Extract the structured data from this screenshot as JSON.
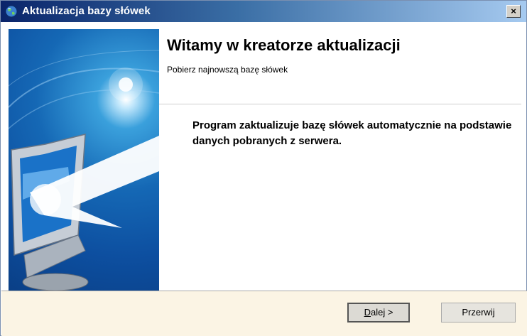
{
  "window": {
    "title": "Aktualizacja bazy słówek",
    "close_glyph": "×"
  },
  "header": {
    "title": "Witamy w kreatorze aktualizacji",
    "subtitle": "Pobierz najnowszą bazę słówek"
  },
  "body": {
    "text": "Program zaktualizuje bazę słówek automatycznie na podstawie danych pobranych z serwera."
  },
  "buttons": {
    "next_accel": "D",
    "next_rest": "alej >",
    "cancel": "Przerwij"
  },
  "icons": {
    "app": "globe-icon",
    "side": "monitor-illustration"
  },
  "colors": {
    "title_bar_start": "#0a246a",
    "title_bar_end": "#a6caf0",
    "side_panel": "#1568b5",
    "footer": "#fbf4e4"
  }
}
